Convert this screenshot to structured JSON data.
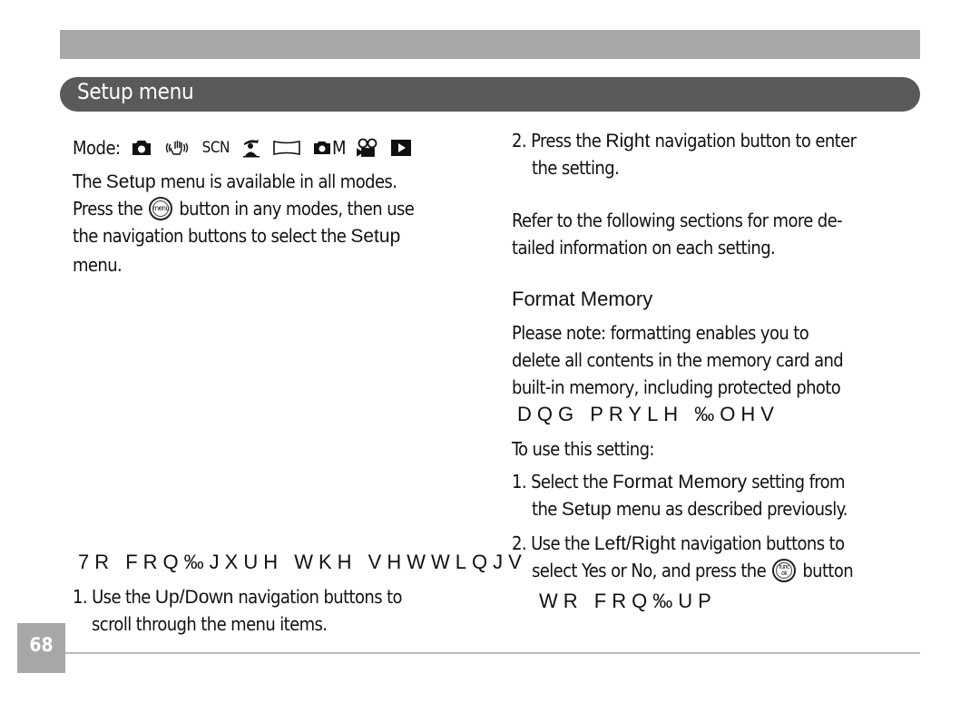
{
  "header": {
    "section_title": "Setup menu"
  },
  "left": {
    "mode_label": "Mode:",
    "mode_icons": [
      "camera-auto-icon",
      "anti-shake-hand-icon",
      "scn-text-icon",
      "portrait-scene-icon",
      "panorama-icon",
      "camera-manual-icon",
      "video-camera-icon",
      "playback-icon"
    ],
    "scn_text": "SCN",
    "manual_m": "M",
    "intro": {
      "l1_pre": "The ",
      "l1_kw": "Setup",
      "l1_post": " menu is available in all modes.",
      "l2_pre": "Press the ",
      "menu_btn": "menu",
      "l2_post": " button in any modes, then use",
      "l3_pre": "the navigation buttons to select the ",
      "l3_kw": "Setup",
      "l4": "menu."
    },
    "garbled_heading": "7R FRQ‰JXUH WKH VHWWLQJV",
    "step1": {
      "num": "1.",
      "l1_pre": "Use the ",
      "l1_kw": "Up/Down",
      "l1_post": " navigation buttons to",
      "l2": "scroll through the menu items."
    }
  },
  "right": {
    "step2": {
      "num": "2.",
      "l1_pre": "Press the ",
      "l1_kw": "Right",
      "l1_post": " navigation button to enter",
      "l2": "the setting."
    },
    "refer": {
      "l1": "Refer to the following sections for more de-",
      "l2": "tailed information on each setting."
    },
    "format_heading": "Format Memory",
    "note": {
      "l1": "Please note:  formatting enables you to",
      "l2": "delete all contents in the memory card and",
      "l3": "built-in memory, including protected photo",
      "l4_garbled": "DQG PRYLH ‰OHV"
    },
    "use_label": "To use this setting:",
    "fstep1": {
      "num": "1.",
      "l1_pre": "Select the ",
      "l1_kw": "Format  Memory",
      "l1_post": " setting from",
      "l2_pre": "the ",
      "l2_kw": "Setup",
      "l2_post": " menu as described previously."
    },
    "fstep2": {
      "num": "2.",
      "l1_pre": "Use the ",
      "l1_kw": "Left/Right",
      "l1_post": "  navigation buttons to",
      "l2_pre": "select Yes or No, and press the ",
      "func_btn_top": "func",
      "func_btn_bottom": "ok",
      "l2_post": " button",
      "l3_garbled": "WR FRQ‰UP"
    }
  },
  "footer": {
    "page_number": "68"
  }
}
